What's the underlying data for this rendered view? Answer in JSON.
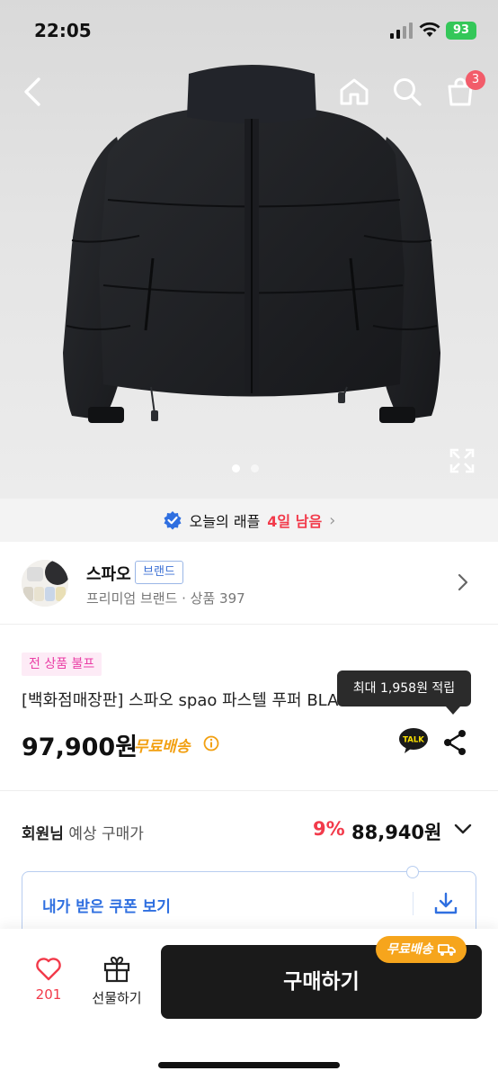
{
  "status": {
    "time": "22:05",
    "battery": "93"
  },
  "nav": {
    "cart_count": "3"
  },
  "hero": {
    "page_count": 2,
    "active_page": 1
  },
  "raffle": {
    "prefix": "오늘의 래플",
    "remaining": "4일 남음"
  },
  "brand": {
    "name": "스파오",
    "tag": "브랜드",
    "subtitle": "프리미엄 브랜드 · 상품 397"
  },
  "product": {
    "sale_tag": "전 상품 불프",
    "title": "[백화점매장판] 스파오 spao 파스텔 푸퍼 BLACK",
    "price": "97,900원",
    "free_shipping": "무료배송",
    "tooltip": "최대 1,958원 적립"
  },
  "member": {
    "who": "회원님",
    "label": "예상 구매가",
    "discount": "9%",
    "price": "88,940원"
  },
  "coupon": {
    "label": "내가 받은 쿠폰 보기"
  },
  "bottom": {
    "like_count": "201",
    "gift_label": "선물하기",
    "buy_label": "구매하기",
    "ship_badge": "무료배송"
  },
  "colors": {
    "accent_red": "#f23a4a",
    "accent_blue": "#2f6fe0",
    "accent_orange": "#f6a51c",
    "sale_pink": "#ea3ea5"
  }
}
